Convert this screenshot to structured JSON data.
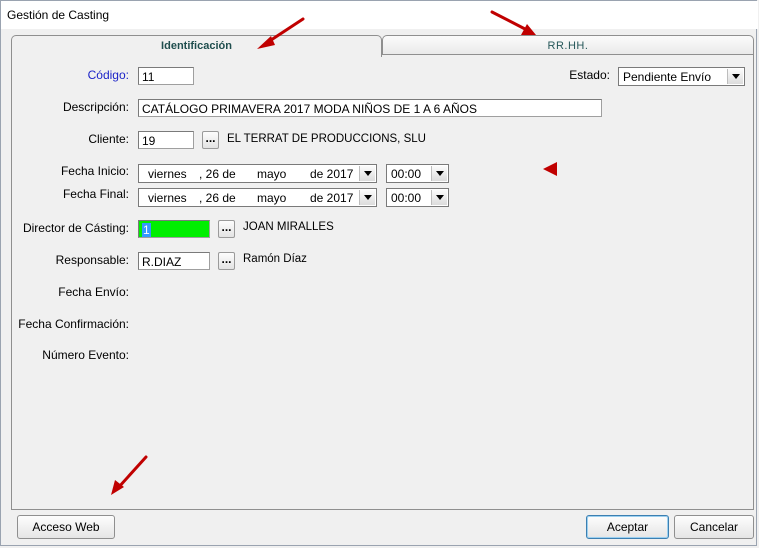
{
  "window": {
    "title": "Gestión de Casting"
  },
  "tabs": [
    {
      "label": "Identificación",
      "active": true
    },
    {
      "label": "RR.HH.",
      "active": false
    }
  ],
  "form": {
    "codigo": {
      "label": "Código:",
      "value": "11"
    },
    "estado": {
      "label": "Estado:",
      "value": "Pendiente Envío"
    },
    "descripcion": {
      "label": "Descripción:",
      "value": "CATÁLOGO PRIMAVERA 2017 MODA NIÑOS DE 1 A 6 AÑOS"
    },
    "cliente": {
      "label": "Cliente:",
      "value": "19",
      "button": "...",
      "name": "EL TERRAT DE PRODUCCIONS, SLU"
    },
    "fecha_inicio": {
      "label": "Fecha Inicio:",
      "weekday": "viernes",
      "day": ", 26 de",
      "month": "mayo",
      "year": "de 2017",
      "time": "00:00"
    },
    "fecha_final": {
      "label": "Fecha Final:",
      "weekday": "viernes",
      "day": ", 26 de",
      "month": "mayo",
      "year": "de 2017",
      "time": "00:00"
    },
    "director": {
      "label": "Director de Cásting:",
      "value": "1",
      "button": "...",
      "name": "JOAN MIRALLES"
    },
    "responsable": {
      "label": "Responsable:",
      "value": "R.DIAZ",
      "button": "...",
      "name": "Ramón Díaz"
    },
    "fecha_envio": {
      "label": "Fecha Envío:"
    },
    "fecha_confirmacion": {
      "label": "Fecha Confirmación:"
    },
    "numero_evento": {
      "label": "Número Evento:"
    }
  },
  "footer": {
    "acceso_web": "Acceso Web",
    "aceptar": "Aceptar",
    "cancelar": "Cancelar"
  },
  "colors": {
    "annotation_arrow": "#c00000",
    "director_field_bg": "#00ee00",
    "label_blue": "#1c24c8"
  },
  "annotations": [
    "arrow-icon",
    "arrow-icon",
    "arrow-icon",
    "triangle-marker-icon"
  ]
}
